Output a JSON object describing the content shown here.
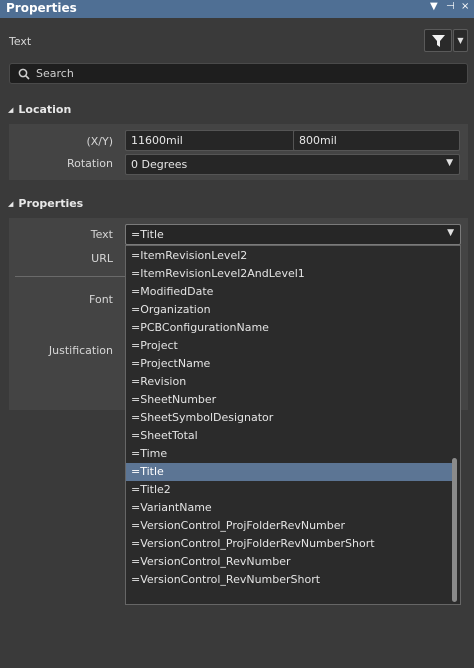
{
  "panel": {
    "title": "Properties",
    "controls": [
      "▼",
      "⊣",
      "×"
    ],
    "object_type": "Text"
  },
  "search": {
    "placeholder": "Search"
  },
  "location": {
    "heading": "Location",
    "xy_label": "(X/Y)",
    "x_value": "11600mil",
    "y_value": "800mil",
    "rotation_label": "Rotation",
    "rotation_value": "0 Degrees"
  },
  "properties": {
    "heading": "Properties",
    "text_label": "Text",
    "text_value": "=Title",
    "url_label": "URL",
    "font_label": "Font",
    "justification_label": "Justification"
  },
  "dropdown": {
    "items": [
      "=ItemRevisionLevel2",
      "=ItemRevisionLevel2AndLevel1",
      "=ModifiedDate",
      "=Organization",
      "=PCBConfigurationName",
      "=Project",
      "=ProjectName",
      "=Revision",
      "=SheetNumber",
      "=SheetSymbolDesignator",
      "=SheetTotal",
      "=Time",
      "=Title",
      "=Title2",
      "=VariantName",
      "=VersionControl_ProjFolderRevNumber",
      "=VersionControl_ProjFolderRevNumberShort",
      "=VersionControl_RevNumber",
      "=VersionControl_RevNumberShort"
    ],
    "selected_index": 12
  },
  "colors": {
    "titlebar": "#4f6f94",
    "background": "#3a3a3a",
    "selection": "#5c7594"
  },
  "icons": {
    "filter": "filter-icon",
    "search": "search-icon",
    "dropdown": "chevron-down-icon",
    "collapse": "collapse-triangle-icon"
  }
}
